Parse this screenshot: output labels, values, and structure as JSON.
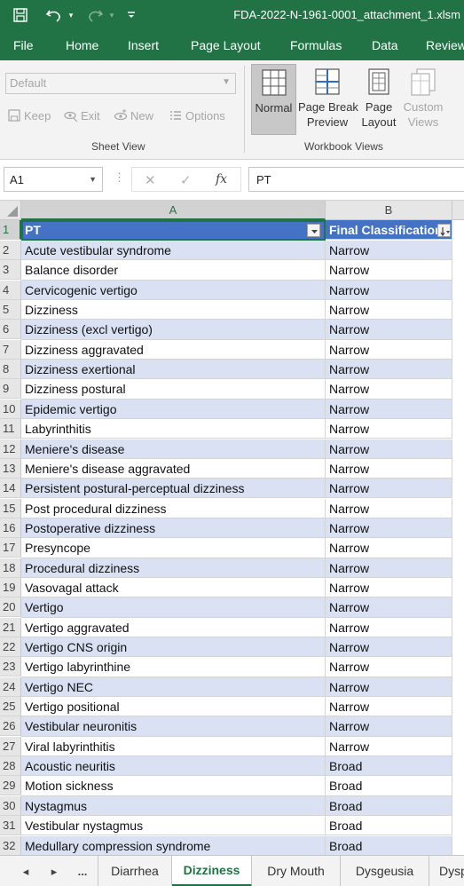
{
  "titlebar": {
    "filename": "FDA-2022-N-1961-0001_attachment_1.xlsm",
    "icons": [
      "save-icon",
      "undo-icon",
      "redo-icon",
      "customize-icon"
    ]
  },
  "ribbon_tabs": [
    "File",
    "Home",
    "Insert",
    "Page Layout",
    "Formulas",
    "Data",
    "Review"
  ],
  "sheet_view": {
    "select_value": "Default",
    "keep_label": "Keep",
    "exit_label": "Exit",
    "new_label": "New",
    "options_label": "Options",
    "group_label": "Sheet View"
  },
  "workbook_views": {
    "normal_label": "Normal",
    "page_break_line1": "Page Break",
    "page_break_line2": "Preview",
    "page_layout_line1": "Page",
    "page_layout_line2": "Layout",
    "custom_line1": "Custom",
    "custom_line2": "Views",
    "group_label": "Workbook Views"
  },
  "formula_bar": {
    "name_box": "A1",
    "fx_label": "fx",
    "formula": "PT"
  },
  "columns": [
    "A",
    "B"
  ],
  "header_row": {
    "pt": "PT",
    "classification": "Final Classification"
  },
  "rows": [
    {
      "n": "2",
      "pt": "Acute vestibular syndrome",
      "cls": "Narrow"
    },
    {
      "n": "3",
      "pt": "Balance disorder",
      "cls": "Narrow"
    },
    {
      "n": "4",
      "pt": "Cervicogenic vertigo",
      "cls": "Narrow"
    },
    {
      "n": "5",
      "pt": "Dizziness",
      "cls": "Narrow"
    },
    {
      "n": "6",
      "pt": "Dizziness (excl vertigo)",
      "cls": "Narrow"
    },
    {
      "n": "7",
      "pt": "Dizziness aggravated",
      "cls": "Narrow"
    },
    {
      "n": "8",
      "pt": "Dizziness exertional",
      "cls": "Narrow"
    },
    {
      "n": "9",
      "pt": "Dizziness postural",
      "cls": "Narrow"
    },
    {
      "n": "10",
      "pt": "Epidemic vertigo",
      "cls": "Narrow"
    },
    {
      "n": "11",
      "pt": "Labyrinthitis",
      "cls": "Narrow"
    },
    {
      "n": "12",
      "pt": "Meniere's disease",
      "cls": "Narrow"
    },
    {
      "n": "13",
      "pt": "Meniere's disease aggravated",
      "cls": "Narrow"
    },
    {
      "n": "14",
      "pt": "Persistent postural-perceptual dizziness",
      "cls": "Narrow"
    },
    {
      "n": "15",
      "pt": "Post procedural dizziness",
      "cls": "Narrow"
    },
    {
      "n": "16",
      "pt": "Postoperative dizziness",
      "cls": "Narrow"
    },
    {
      "n": "17",
      "pt": "Presyncope",
      "cls": "Narrow"
    },
    {
      "n": "18",
      "pt": "Procedural dizziness",
      "cls": "Narrow"
    },
    {
      "n": "19",
      "pt": "Vasovagal attack",
      "cls": "Narrow"
    },
    {
      "n": "20",
      "pt": "Vertigo",
      "cls": "Narrow"
    },
    {
      "n": "21",
      "pt": "Vertigo aggravated",
      "cls": "Narrow"
    },
    {
      "n": "22",
      "pt": "Vertigo CNS origin",
      "cls": "Narrow"
    },
    {
      "n": "23",
      "pt": "Vertigo labyrinthine",
      "cls": "Narrow"
    },
    {
      "n": "24",
      "pt": "Vertigo NEC",
      "cls": "Narrow"
    },
    {
      "n": "25",
      "pt": "Vertigo positional",
      "cls": "Narrow"
    },
    {
      "n": "26",
      "pt": "Vestibular neuronitis",
      "cls": "Narrow"
    },
    {
      "n": "27",
      "pt": "Viral labyrinthitis",
      "cls": "Narrow"
    },
    {
      "n": "28",
      "pt": "Acoustic neuritis",
      "cls": "Broad"
    },
    {
      "n": "29",
      "pt": "Motion sickness",
      "cls": "Broad"
    },
    {
      "n": "30",
      "pt": "Nystagmus",
      "cls": "Broad"
    },
    {
      "n": "31",
      "pt": "Vestibular nystagmus",
      "cls": "Broad"
    },
    {
      "n": "32",
      "pt": "Medullary compression syndrome",
      "cls": "Broad"
    }
  ],
  "sheet_tabs": {
    "more": "...",
    "tabs": [
      "Diarrhea",
      "Dizziness",
      "Dry Mouth",
      "Dysgeusia",
      "Dysp"
    ],
    "active": "Dizziness"
  },
  "colors": {
    "excel_green": "#217346",
    "table_header": "#4472c4",
    "band_row": "#d9e1f2"
  }
}
